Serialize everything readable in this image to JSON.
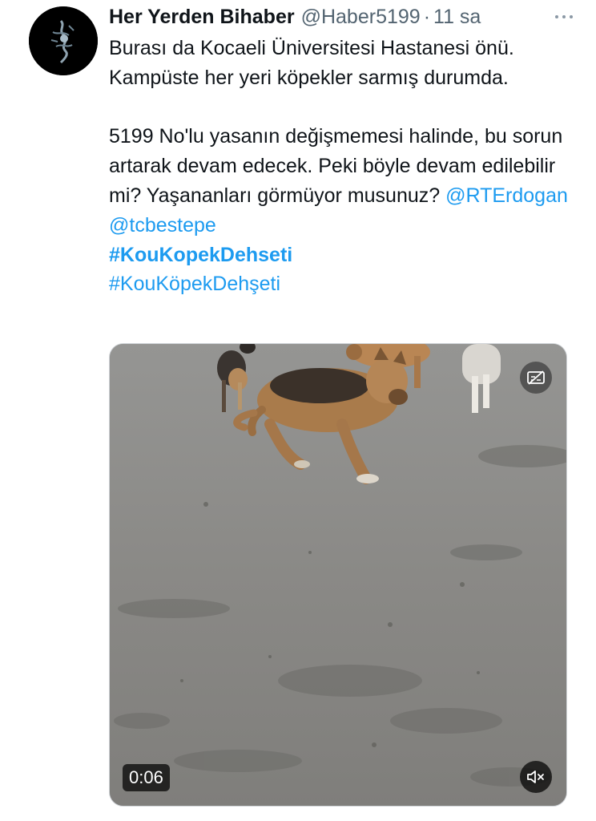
{
  "tweet": {
    "author_name": "Her Yerden Bihaber",
    "handle": "@Haber5199",
    "separator": "·",
    "time": "11 sa",
    "text_para1": "Burası da Kocaeli Üniversitesi Hastanesi önü. Kampüste her yeri köpekler sarmış durumda.",
    "text_para2": "5199 No'lu yasanın değişmemesi halinde, bu sorun artarak devam edecek. Peki böyle devam edilebilir mi? Yaşananları görmüyor musunuz?",
    "mention1": "@RTErdogan",
    "mention2": "@tcbestepe",
    "hashtag1": "#KouKopekDehseti",
    "hashtag2": "#KouKöpekDehşeti"
  },
  "media": {
    "duration": "0:06"
  },
  "icons": {
    "avatar": "avatar-image",
    "more": "more-options-icon",
    "captions": "captions-off-icon",
    "mute": "speaker-muted-icon"
  },
  "colors": {
    "text": "#0f1419",
    "secondary": "#536471",
    "link": "#1d9bf0",
    "background": "#ffffff"
  }
}
